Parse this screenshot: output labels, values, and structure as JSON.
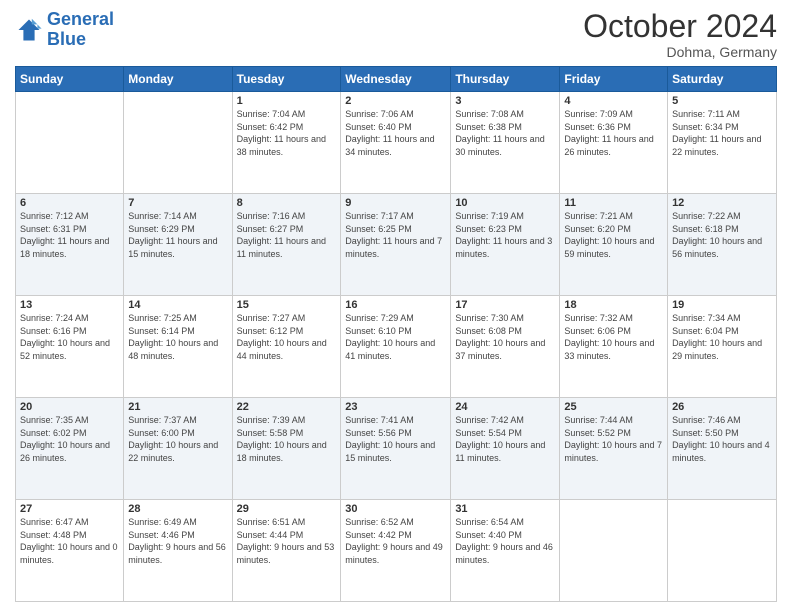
{
  "logo": {
    "line1": "General",
    "line2": "Blue"
  },
  "header": {
    "month": "October 2024",
    "location": "Dohma, Germany"
  },
  "weekdays": [
    "Sunday",
    "Monday",
    "Tuesday",
    "Wednesday",
    "Thursday",
    "Friday",
    "Saturday"
  ],
  "weeks": [
    [
      {
        "day": "",
        "info": ""
      },
      {
        "day": "",
        "info": ""
      },
      {
        "day": "1",
        "info": "Sunrise: 7:04 AM\nSunset: 6:42 PM\nDaylight: 11 hours and 38 minutes."
      },
      {
        "day": "2",
        "info": "Sunrise: 7:06 AM\nSunset: 6:40 PM\nDaylight: 11 hours and 34 minutes."
      },
      {
        "day": "3",
        "info": "Sunrise: 7:08 AM\nSunset: 6:38 PM\nDaylight: 11 hours and 30 minutes."
      },
      {
        "day": "4",
        "info": "Sunrise: 7:09 AM\nSunset: 6:36 PM\nDaylight: 11 hours and 26 minutes."
      },
      {
        "day": "5",
        "info": "Sunrise: 7:11 AM\nSunset: 6:34 PM\nDaylight: 11 hours and 22 minutes."
      }
    ],
    [
      {
        "day": "6",
        "info": "Sunrise: 7:12 AM\nSunset: 6:31 PM\nDaylight: 11 hours and 18 minutes."
      },
      {
        "day": "7",
        "info": "Sunrise: 7:14 AM\nSunset: 6:29 PM\nDaylight: 11 hours and 15 minutes."
      },
      {
        "day": "8",
        "info": "Sunrise: 7:16 AM\nSunset: 6:27 PM\nDaylight: 11 hours and 11 minutes."
      },
      {
        "day": "9",
        "info": "Sunrise: 7:17 AM\nSunset: 6:25 PM\nDaylight: 11 hours and 7 minutes."
      },
      {
        "day": "10",
        "info": "Sunrise: 7:19 AM\nSunset: 6:23 PM\nDaylight: 11 hours and 3 minutes."
      },
      {
        "day": "11",
        "info": "Sunrise: 7:21 AM\nSunset: 6:20 PM\nDaylight: 10 hours and 59 minutes."
      },
      {
        "day": "12",
        "info": "Sunrise: 7:22 AM\nSunset: 6:18 PM\nDaylight: 10 hours and 56 minutes."
      }
    ],
    [
      {
        "day": "13",
        "info": "Sunrise: 7:24 AM\nSunset: 6:16 PM\nDaylight: 10 hours and 52 minutes."
      },
      {
        "day": "14",
        "info": "Sunrise: 7:25 AM\nSunset: 6:14 PM\nDaylight: 10 hours and 48 minutes."
      },
      {
        "day": "15",
        "info": "Sunrise: 7:27 AM\nSunset: 6:12 PM\nDaylight: 10 hours and 44 minutes."
      },
      {
        "day": "16",
        "info": "Sunrise: 7:29 AM\nSunset: 6:10 PM\nDaylight: 10 hours and 41 minutes."
      },
      {
        "day": "17",
        "info": "Sunrise: 7:30 AM\nSunset: 6:08 PM\nDaylight: 10 hours and 37 minutes."
      },
      {
        "day": "18",
        "info": "Sunrise: 7:32 AM\nSunset: 6:06 PM\nDaylight: 10 hours and 33 minutes."
      },
      {
        "day": "19",
        "info": "Sunrise: 7:34 AM\nSunset: 6:04 PM\nDaylight: 10 hours and 29 minutes."
      }
    ],
    [
      {
        "day": "20",
        "info": "Sunrise: 7:35 AM\nSunset: 6:02 PM\nDaylight: 10 hours and 26 minutes."
      },
      {
        "day": "21",
        "info": "Sunrise: 7:37 AM\nSunset: 6:00 PM\nDaylight: 10 hours and 22 minutes."
      },
      {
        "day": "22",
        "info": "Sunrise: 7:39 AM\nSunset: 5:58 PM\nDaylight: 10 hours and 18 minutes."
      },
      {
        "day": "23",
        "info": "Sunrise: 7:41 AM\nSunset: 5:56 PM\nDaylight: 10 hours and 15 minutes."
      },
      {
        "day": "24",
        "info": "Sunrise: 7:42 AM\nSunset: 5:54 PM\nDaylight: 10 hours and 11 minutes."
      },
      {
        "day": "25",
        "info": "Sunrise: 7:44 AM\nSunset: 5:52 PM\nDaylight: 10 hours and 7 minutes."
      },
      {
        "day": "26",
        "info": "Sunrise: 7:46 AM\nSunset: 5:50 PM\nDaylight: 10 hours and 4 minutes."
      }
    ],
    [
      {
        "day": "27",
        "info": "Sunrise: 6:47 AM\nSunset: 4:48 PM\nDaylight: 10 hours and 0 minutes."
      },
      {
        "day": "28",
        "info": "Sunrise: 6:49 AM\nSunset: 4:46 PM\nDaylight: 9 hours and 56 minutes."
      },
      {
        "day": "29",
        "info": "Sunrise: 6:51 AM\nSunset: 4:44 PM\nDaylight: 9 hours and 53 minutes."
      },
      {
        "day": "30",
        "info": "Sunrise: 6:52 AM\nSunset: 4:42 PM\nDaylight: 9 hours and 49 minutes."
      },
      {
        "day": "31",
        "info": "Sunrise: 6:54 AM\nSunset: 4:40 PM\nDaylight: 9 hours and 46 minutes."
      },
      {
        "day": "",
        "info": ""
      },
      {
        "day": "",
        "info": ""
      }
    ]
  ]
}
